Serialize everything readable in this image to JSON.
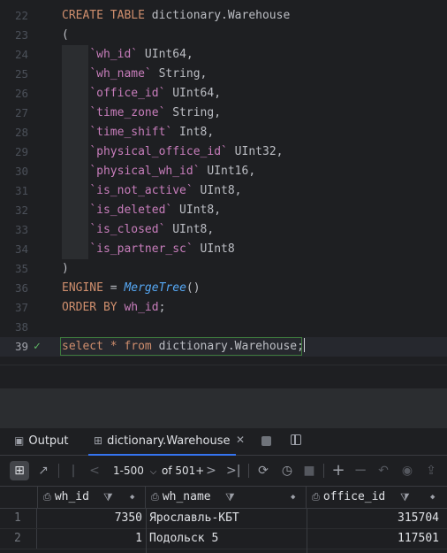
{
  "editor": {
    "lines": [
      {
        "n": "22",
        "tokens": [
          {
            "t": "CREATE TABLE ",
            "c": "kw"
          },
          {
            "t": "dictionary.Warehouse",
            "c": "tx"
          }
        ]
      },
      {
        "n": "23",
        "tokens": [
          {
            "t": "(",
            "c": "tx"
          }
        ]
      },
      {
        "n": "24",
        "tokens": [
          {
            "t": "    ",
            "c": "tx"
          },
          {
            "t": "`wh_id`",
            "c": "col"
          },
          {
            "t": " UInt64,",
            "c": "tx"
          }
        ]
      },
      {
        "n": "25",
        "tokens": [
          {
            "t": "    ",
            "c": "tx"
          },
          {
            "t": "`wh_name`",
            "c": "col"
          },
          {
            "t": " String,",
            "c": "tx"
          }
        ]
      },
      {
        "n": "26",
        "tokens": [
          {
            "t": "    ",
            "c": "tx"
          },
          {
            "t": "`office_id`",
            "c": "col"
          },
          {
            "t": " UInt64,",
            "c": "tx"
          }
        ]
      },
      {
        "n": "27",
        "tokens": [
          {
            "t": "    ",
            "c": "tx"
          },
          {
            "t": "`time_zone`",
            "c": "col"
          },
          {
            "t": " String,",
            "c": "tx"
          }
        ]
      },
      {
        "n": "28",
        "tokens": [
          {
            "t": "    ",
            "c": "tx"
          },
          {
            "t": "`time_shift`",
            "c": "col"
          },
          {
            "t": " Int8,",
            "c": "tx"
          }
        ]
      },
      {
        "n": "29",
        "tokens": [
          {
            "t": "    ",
            "c": "tx"
          },
          {
            "t": "`physical_office_id`",
            "c": "col"
          },
          {
            "t": " UInt32,",
            "c": "tx"
          }
        ]
      },
      {
        "n": "30",
        "tokens": [
          {
            "t": "    ",
            "c": "tx"
          },
          {
            "t": "`physical_wh_id`",
            "c": "col"
          },
          {
            "t": " UInt16,",
            "c": "tx"
          }
        ]
      },
      {
        "n": "31",
        "tokens": [
          {
            "t": "    ",
            "c": "tx"
          },
          {
            "t": "`is_not_active`",
            "c": "col"
          },
          {
            "t": " UInt8,",
            "c": "tx"
          }
        ]
      },
      {
        "n": "32",
        "tokens": [
          {
            "t": "    ",
            "c": "tx"
          },
          {
            "t": "`is_deleted`",
            "c": "col"
          },
          {
            "t": " UInt8,",
            "c": "tx"
          }
        ]
      },
      {
        "n": "33",
        "tokens": [
          {
            "t": "    ",
            "c": "tx"
          },
          {
            "t": "`is_closed`",
            "c": "col"
          },
          {
            "t": " UInt8,",
            "c": "tx"
          }
        ]
      },
      {
        "n": "34",
        "tokens": [
          {
            "t": "    ",
            "c": "tx"
          },
          {
            "t": "`is_partner_sc`",
            "c": "col"
          },
          {
            "t": " UInt8",
            "c": "tx"
          }
        ]
      },
      {
        "n": "35",
        "tokens": [
          {
            "t": ")",
            "c": "tx"
          }
        ]
      },
      {
        "n": "36",
        "tokens": [
          {
            "t": "ENGINE",
            "c": "kw"
          },
          {
            "t": " = ",
            "c": "tx"
          },
          {
            "t": "MergeTree",
            "c": "fn"
          },
          {
            "t": "()",
            "c": "tx"
          }
        ]
      },
      {
        "n": "37",
        "tokens": [
          {
            "t": "ORDER BY ",
            "c": "kw"
          },
          {
            "t": "wh_id",
            "c": "col"
          },
          {
            "t": ";",
            "c": "tx"
          }
        ]
      },
      {
        "n": "38",
        "tokens": []
      },
      {
        "n": "39",
        "tokens": [
          {
            "t": "select ",
            "c": "kw"
          },
          {
            "t": "* ",
            "c": "kw"
          },
          {
            "t": "from ",
            "c": "kw"
          },
          {
            "t": "dictionary.Warehouse",
            "c": "tx"
          },
          {
            "t": ";",
            "c": "tx"
          }
        ],
        "current": true,
        "mark": "✓"
      }
    ]
  },
  "bottom": {
    "tabs": [
      {
        "label": "Output",
        "icon": "terminal-icon"
      },
      {
        "label": "dictionary.Warehouse",
        "icon": "table-icon",
        "active": true
      }
    ],
    "close_glyph": "✕",
    "pager": {
      "range": "1-500",
      "of": "of 501+"
    }
  },
  "grid": {
    "columns": [
      {
        "name": "wh_id"
      },
      {
        "name": "wh_name"
      },
      {
        "name": "office_id"
      }
    ],
    "rows": [
      {
        "n": "1",
        "wh_id": "7350",
        "wh_name": "Ярославль-КБТ",
        "office_id": "315704"
      },
      {
        "n": "2",
        "wh_id": "1",
        "wh_name": "Подольск 5",
        "office_id": "117501"
      }
    ]
  },
  "colors": {
    "accent": "#3574f0",
    "keyword": "#cf8e6d",
    "column": "#c77dbb",
    "function": "#56a8f5",
    "check": "#5fb865"
  }
}
